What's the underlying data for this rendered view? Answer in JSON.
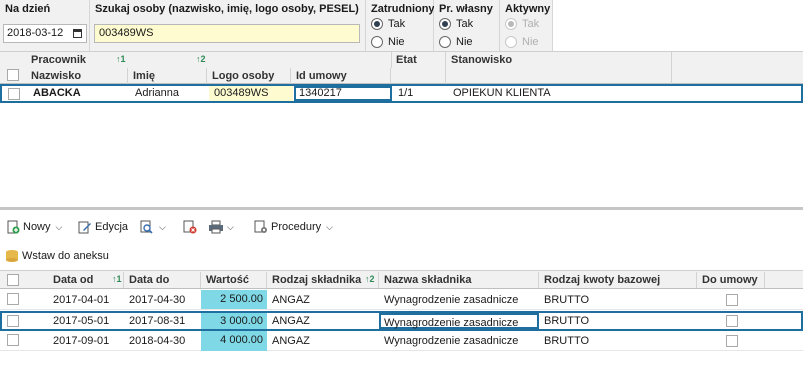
{
  "filters": {
    "date_label": "Na dzień",
    "date_value": "2018-03-12",
    "search_label": "Szukaj osoby (nazwisko, imię, logo osoby, PESEL)",
    "search_value": "003489WS",
    "employed_label": "Zatrudniony",
    "own_label": "Pr. własny",
    "active_label": "Aktywny",
    "yes": "Tak",
    "no": "Nie"
  },
  "grid1": {
    "group_header": "Pracownik",
    "sort1": "↑1",
    "sort2": "↑2",
    "columns": [
      "Nazwisko",
      "Imię",
      "Logo osoby",
      "Id umowy",
      "Etat",
      "Stanowisko"
    ],
    "rows": [
      {
        "surname": "ABACKA",
        "name": "Adrianna",
        "logo": "003489WS",
        "contract_id": "1340217",
        "etat": "1/1",
        "position": "OPIEKUN KLIENTA"
      }
    ]
  },
  "toolbar": {
    "new": "Nowy",
    "edit": "Edycja",
    "procedures": "Procedury",
    "insert_annex": "Wstaw do aneksu"
  },
  "grid2": {
    "columns": [
      "Data od",
      "Data do",
      "Wartość",
      "Rodzaj składnika",
      "Nazwa składnika",
      "Rodzaj kwoty bazowej",
      "Do umowy"
    ],
    "sort1": "↑1",
    "sort2": "↑2",
    "rows": [
      {
        "from": "2017-04-01",
        "to": "2017-04-30",
        "value": "2 500.00",
        "type": "ANGAZ",
        "name": "Wynagrodzenie zasadnicze",
        "base": "BRUTTO"
      },
      {
        "from": "2017-05-01",
        "to": "2017-08-31",
        "value": "3 000.00",
        "type": "ANGAZ",
        "name": "Wynagrodzenie zasadnicze",
        "base": "BRUTTO"
      },
      {
        "from": "2017-09-01",
        "to": "2018-04-30",
        "value": "4 000.00",
        "type": "ANGAZ",
        "name": "Wynagrodzenie zasadnicze",
        "base": "BRUTTO"
      }
    ]
  },
  "colors": {
    "accent": "#1e6fa0",
    "highlight": "#fdfbcf",
    "value_cell": "#7fd8e6"
  }
}
